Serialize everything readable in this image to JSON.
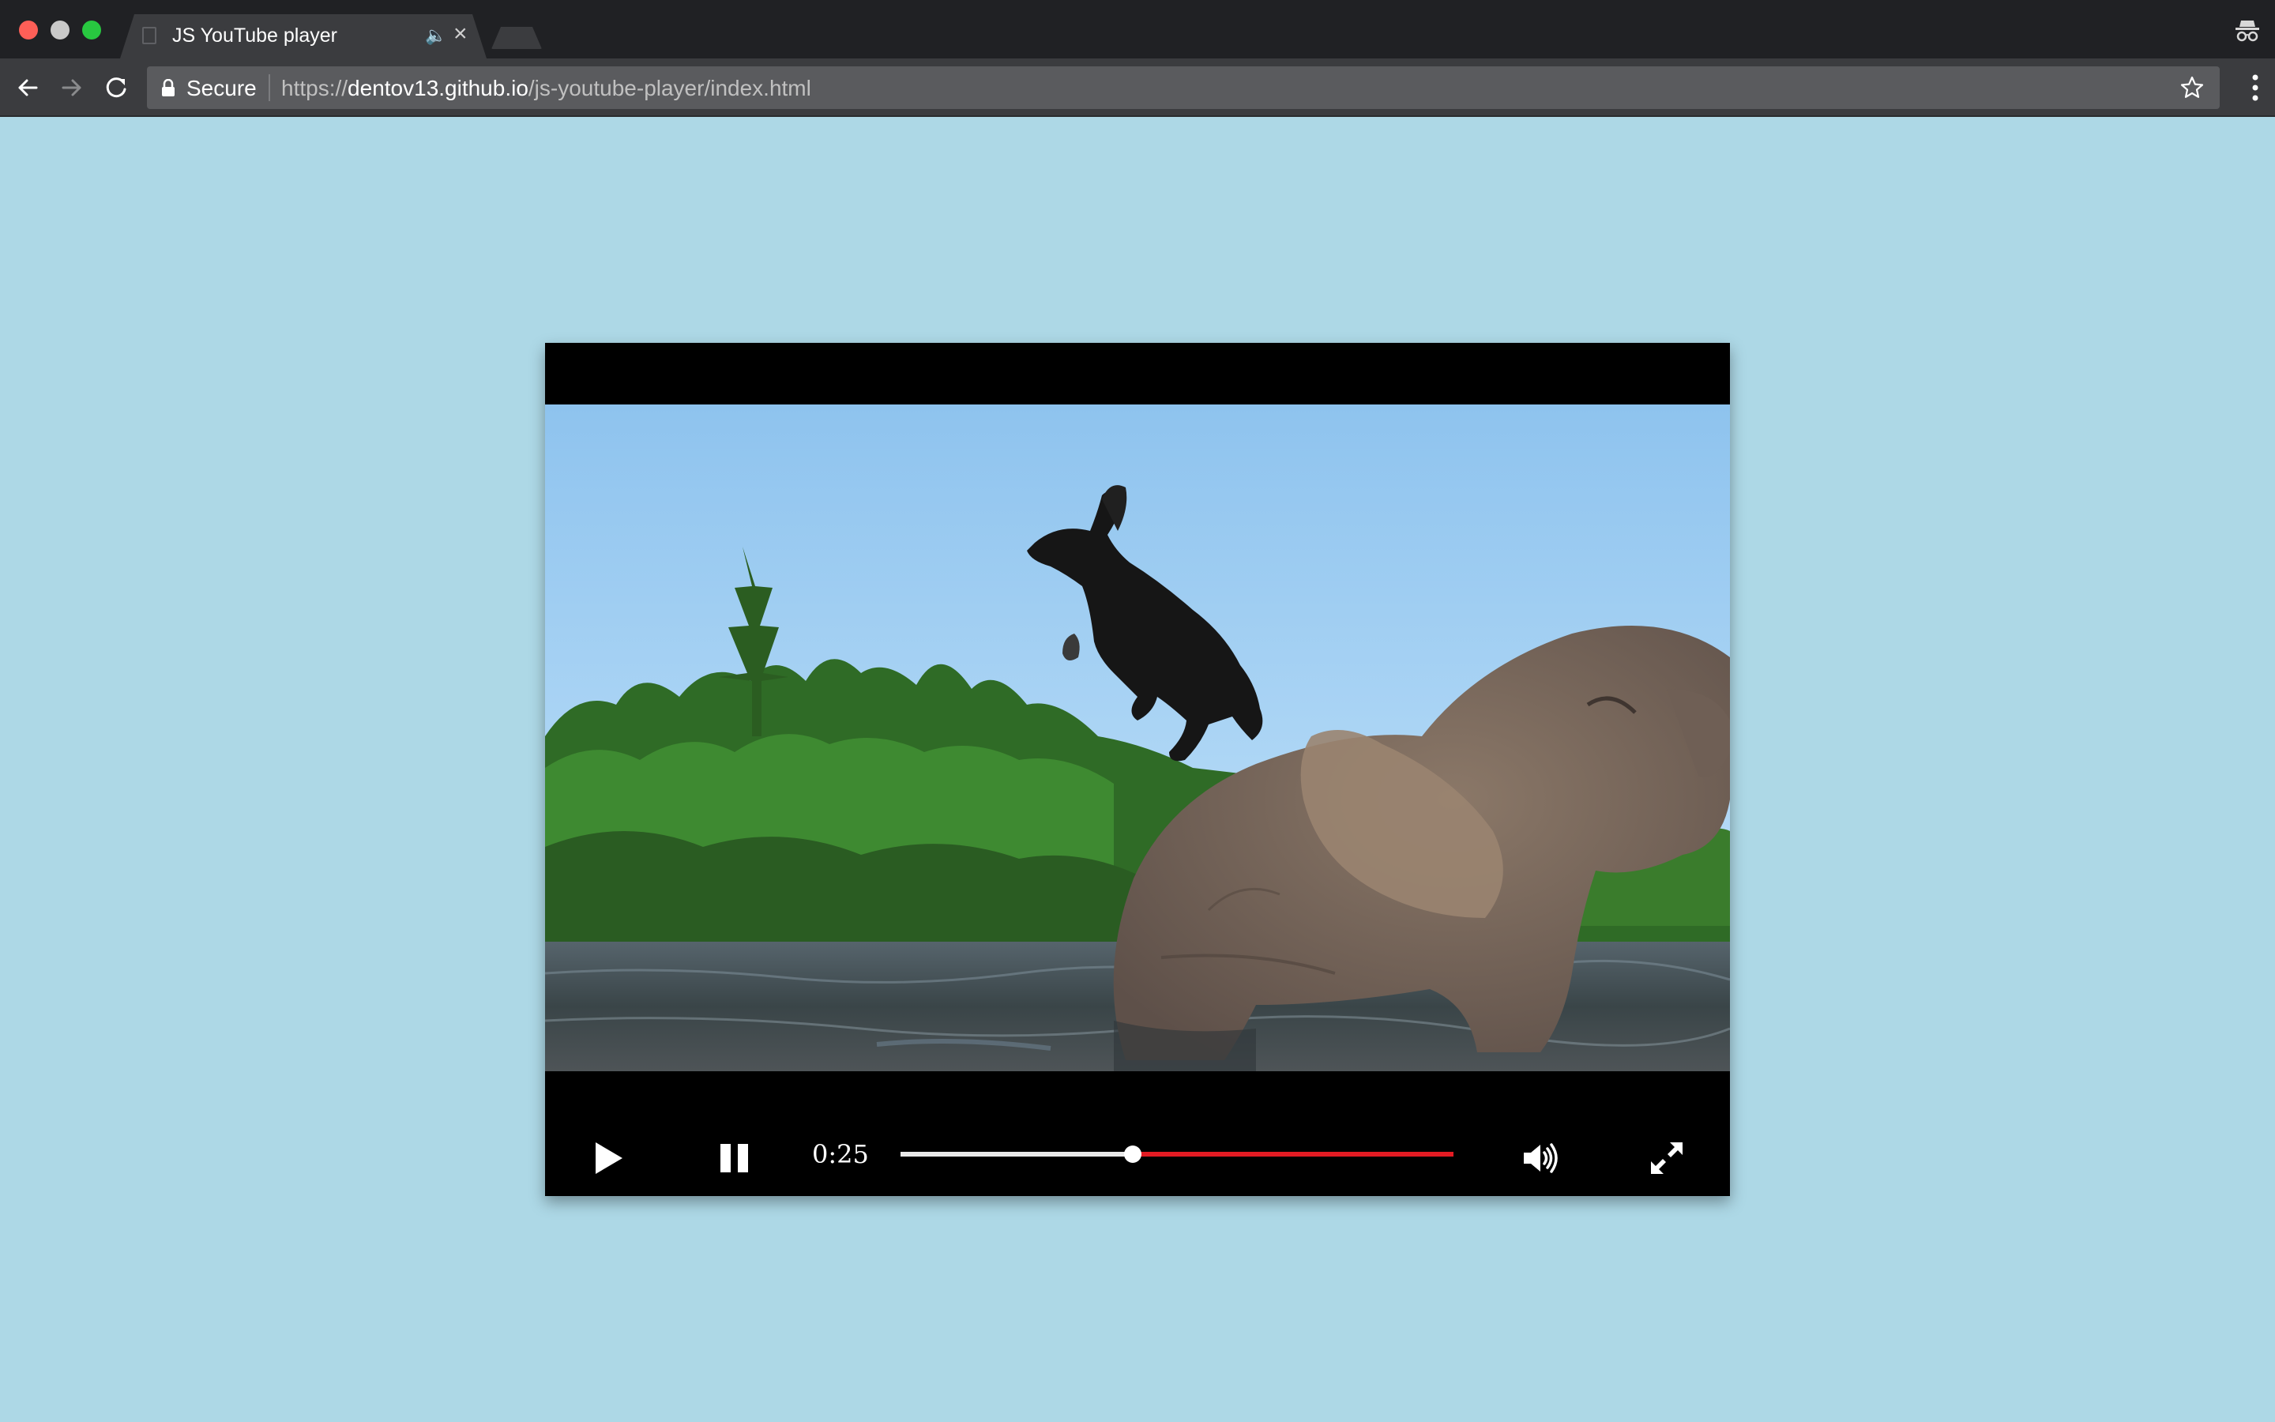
{
  "browser": {
    "tab_title": "JS YouTube player",
    "secure_label": "Secure",
    "url": {
      "scheme": "https://",
      "host": "dentov13.github.io",
      "path": "/js-youtube-player/index.html"
    }
  },
  "player": {
    "current_time": "0:25",
    "progress_fraction": 0.42,
    "colors": {
      "played": "#e9e9e9",
      "remaining": "#e31b23",
      "background": "#add8e6"
    },
    "icons": [
      "play-icon",
      "pause-icon",
      "volume-icon",
      "fullscreen-icon"
    ]
  }
}
